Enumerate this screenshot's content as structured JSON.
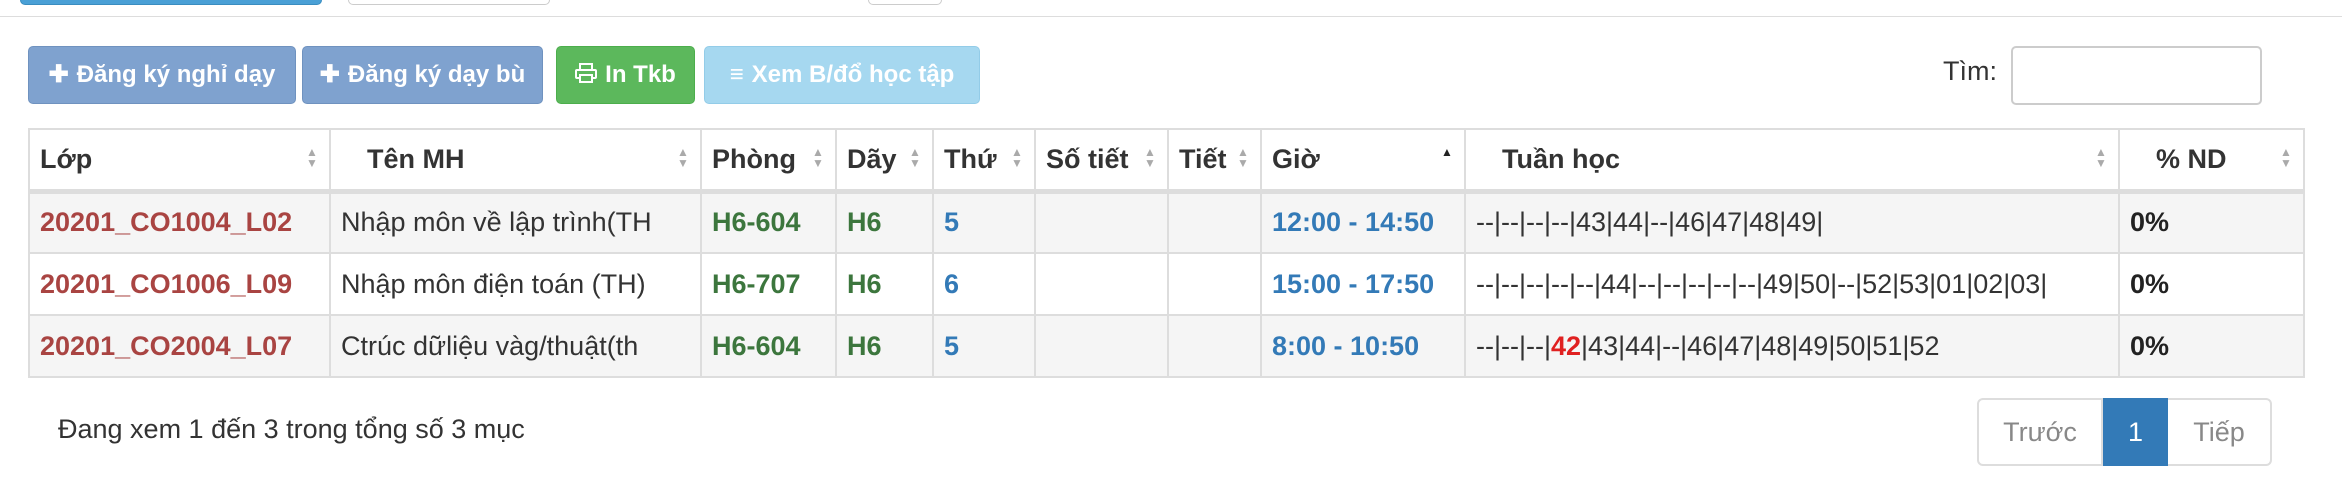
{
  "toolbar": {
    "register_off_label": "Đăng ký nghỉ dạy",
    "register_makeup_label": "Đăng ký dạy bù",
    "print_label": "In Tkb",
    "view_label": "Xem B/đổ học tập"
  },
  "search": {
    "label": "Tìm:",
    "value": ""
  },
  "table": {
    "headers": [
      "Lớp",
      "Tên MH",
      "Phòng",
      "Dãy",
      "Thứ",
      "Số tiết",
      "Tiết",
      "Giờ",
      "Tuần học",
      "% ND"
    ],
    "rows": [
      {
        "lop": "20201_CO1004_L02",
        "ten_mh": "Nhập môn về lập trình(TH",
        "phong": "H6-604",
        "day": "H6",
        "thu": "5",
        "so_tiet": "",
        "tiet": "",
        "gio": "12:00 - 14:50",
        "tuan_hoc_pre": "--|--|--|--|43|44|--|46|47|48|49|",
        "tuan_hoc_hl": "",
        "tuan_hoc_post": "",
        "nd": "0%"
      },
      {
        "lop": "20201_CO1006_L09",
        "ten_mh": "Nhập môn điện toán (TH)",
        "phong": "H6-707",
        "day": "H6",
        "thu": "6",
        "so_tiet": "",
        "tiet": "",
        "gio": "15:00 - 17:50",
        "tuan_hoc_pre": "--|--|--|--|--|44|--|--|--|--|--|49|50|--|52|53|01|02|03|",
        "tuan_hoc_hl": "",
        "tuan_hoc_post": "",
        "nd": "0%"
      },
      {
        "lop": "20201_CO2004_L07",
        "ten_mh": "Ctrúc dữliệu vàg/thuật(th",
        "phong": "H6-604",
        "day": "H6",
        "thu": "5",
        "so_tiet": "",
        "tiet": "",
        "gio": "8:00 - 10:50",
        "tuan_hoc_pre": "--|--|--|",
        "tuan_hoc_hl": "42",
        "tuan_hoc_post": "|43|44|--|46|47|48|49|50|51|52",
        "nd": "0%"
      }
    ]
  },
  "footer": {
    "info": "Đang xem 1 đến 3 trong tổng số 3 mục",
    "prev_label": "Trước",
    "current_page": "1",
    "next_label": "Tiếp"
  },
  "colors": {
    "primary": "#337ab7",
    "danger_text": "#a94442",
    "success_text": "#3c763d",
    "success_button": "#5cb85c",
    "info_button": "#a6d8f0",
    "disabled_primary_button": "#7fa2cf",
    "week_highlight": "#e02020"
  },
  "icons": {
    "register_off": "plus-icon",
    "register_makeup": "plus-icon",
    "print": "print-icon",
    "view": "list-icon",
    "sort": "sort-icon",
    "sort_active": "sort-asc-icon"
  }
}
